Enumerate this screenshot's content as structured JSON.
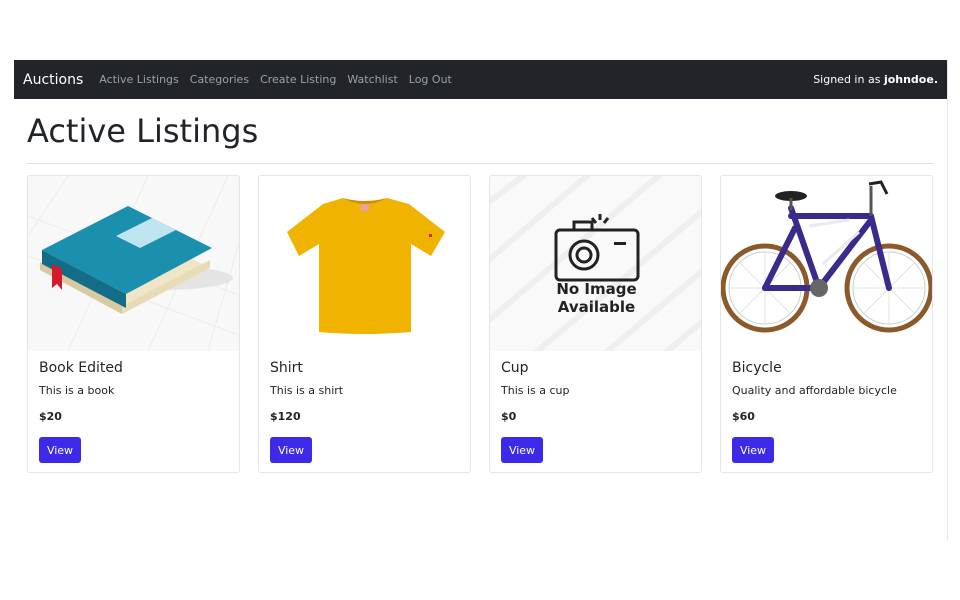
{
  "navbar": {
    "brand": "Auctions",
    "links": [
      "Active Listings",
      "Categories",
      "Create Listing",
      "Watchlist",
      "Log Out"
    ],
    "signed_in_prefix": "Signed in as",
    "username": "johndoe."
  },
  "page": {
    "title": "Active Listings"
  },
  "listings": [
    {
      "title": "Book Edited",
      "description": "This is a book",
      "price": "$20",
      "button": "View",
      "image": "book-illustration"
    },
    {
      "title": "Shirt",
      "description": "This is a shirt",
      "price": "$120",
      "button": "View",
      "image": "yellow-t-shirt"
    },
    {
      "title": "Cup",
      "description": "This is a cup",
      "price": "$0",
      "button": "View",
      "image": "no-image-placeholder",
      "placeholder_text": [
        "No Image",
        "Available"
      ]
    },
    {
      "title": "Bicycle",
      "description": "Quality and affordable bicycle",
      "price": "$60",
      "button": "View",
      "image": "purple-bicycle"
    }
  ],
  "colors": {
    "navbar": "#212529",
    "button": "#3d2ae8",
    "nav_link": "#9aa0a6"
  }
}
